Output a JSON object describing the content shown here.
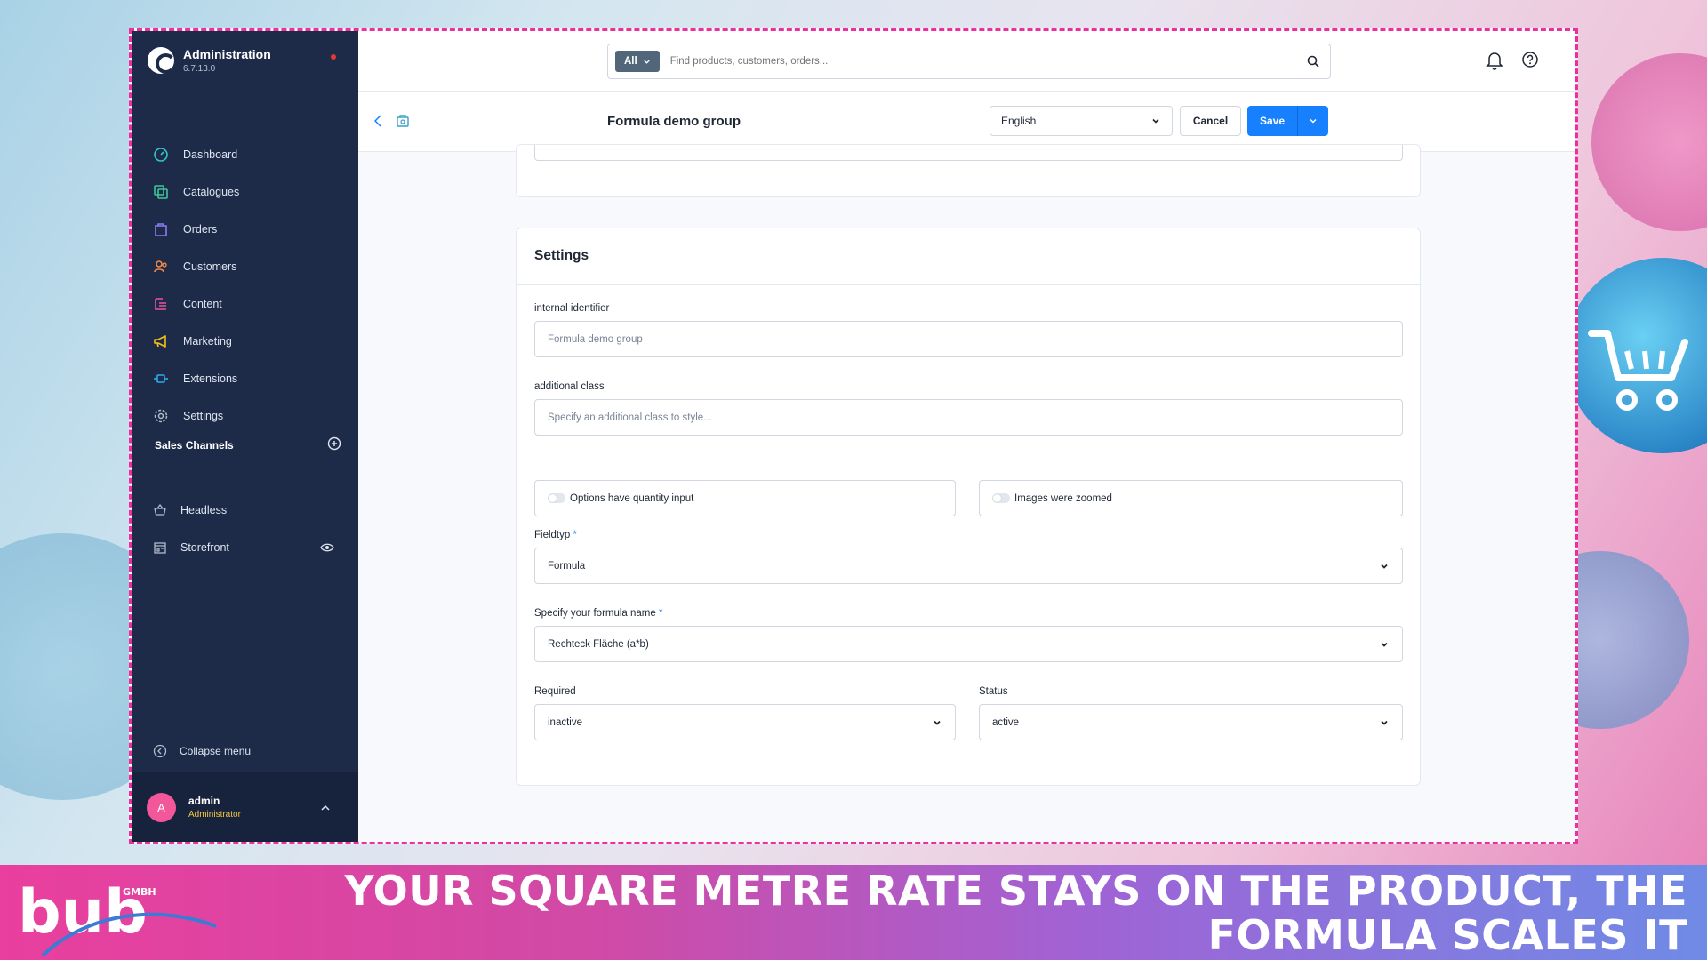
{
  "colors": {
    "accent": "#1780ff",
    "sidebar": "#1d2a48",
    "frame_border": "#ea2f9e",
    "banner_start": "#e93f9e",
    "banner_end": "#6f8be6"
  },
  "app": {
    "title": "Administration",
    "version": "6.7.13.0"
  },
  "nav": [
    {
      "label": "Dashboard",
      "icon": "dashboard-icon"
    },
    {
      "label": "Catalogues",
      "icon": "catalogues-icon"
    },
    {
      "label": "Orders",
      "icon": "orders-icon"
    },
    {
      "label": "Customers",
      "icon": "customers-icon"
    },
    {
      "label": "Content",
      "icon": "content-icon"
    },
    {
      "label": "Marketing",
      "icon": "marketing-icon"
    },
    {
      "label": "Extensions",
      "icon": "extensions-icon"
    },
    {
      "label": "Settings",
      "icon": "settings-icon"
    }
  ],
  "sales_channels": {
    "heading": "Sales Channels",
    "items": [
      {
        "label": "Headless",
        "icon": "basket-icon"
      },
      {
        "label": "Storefront",
        "icon": "storefront-icon"
      }
    ]
  },
  "collapse_label": "Collapse menu",
  "user": {
    "initial": "A",
    "name": "admin",
    "role": "Administrator"
  },
  "search": {
    "type": "All",
    "placeholder": "Find products, customers, orders..."
  },
  "smartbar": {
    "title": "Formula demo group",
    "language": "English",
    "cancel": "Cancel",
    "save": "Save"
  },
  "settings": {
    "title": "Settings",
    "internal_identifier": {
      "label": "internal identifier",
      "placeholder": "Formula demo group"
    },
    "additional_class": {
      "label": "additional class",
      "placeholder": "Specify an additional class to style..."
    },
    "toggle_quantity": {
      "label": "Options have quantity input",
      "value": false
    },
    "toggle_zoom": {
      "label": "Images were zoomed",
      "value": false
    },
    "fieldtype": {
      "label": "Fieldtyp",
      "value": "Formula"
    },
    "formula_name": {
      "label": "Specify your formula name",
      "value": "Rechteck Fläche (a*b)"
    },
    "required": {
      "label": "Required",
      "value": "inactive"
    },
    "status": {
      "label": "Status",
      "value": "active"
    },
    "required_marker": "*"
  },
  "banner": {
    "logo_text": "bub",
    "logo_suffix": "GMBH",
    "headline": "YOUR SQUARE METRE RATE STAYS ON THE PRODUCT, THE FORMULA SCALES IT"
  }
}
